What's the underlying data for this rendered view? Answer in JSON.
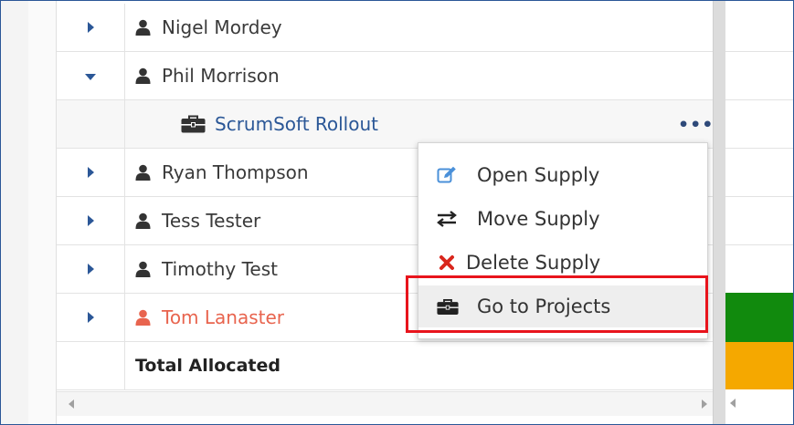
{
  "rows": [
    {
      "label": "Nigel Mordey",
      "expanded": false,
      "icon": "user-icon",
      "style": "normal"
    },
    {
      "label": "Phil Morrison",
      "expanded": true,
      "icon": "user-icon",
      "style": "normal"
    },
    {
      "label": "ScrumSoft Rollout",
      "type": "project",
      "icon": "briefcase-icon",
      "menu": "•••"
    },
    {
      "label": "Ryan Thompson",
      "expanded": false,
      "icon": "user-icon",
      "style": "normal"
    },
    {
      "label": "Tess Tester",
      "expanded": false,
      "icon": "user-icon",
      "style": "normal"
    },
    {
      "label": "Timothy Test",
      "expanded": false,
      "icon": "user-icon",
      "style": "normal"
    },
    {
      "label": "Tom Lanaster",
      "expanded": false,
      "icon": "user-icon",
      "style": "warning"
    },
    {
      "label": "Total Allocated",
      "type": "total"
    }
  ],
  "context_menu": {
    "items": [
      {
        "label": "Open Supply",
        "icon": "edit-icon"
      },
      {
        "label": "Move Supply",
        "icon": "swap-icon"
      },
      {
        "label": "Delete Supply",
        "icon": "delete-icon"
      },
      {
        "label": "Go to Projects",
        "icon": "briefcase-icon",
        "highlighted": true
      }
    ]
  },
  "colors": {
    "link": "#2b5797",
    "warning_user": "#e8644e",
    "allocation_full": "#118a0d",
    "allocation_total": "#f5a800",
    "highlight_border": "#e8141c",
    "delete_icon": "#d9261c",
    "edit_icon": "#4a90d9"
  }
}
